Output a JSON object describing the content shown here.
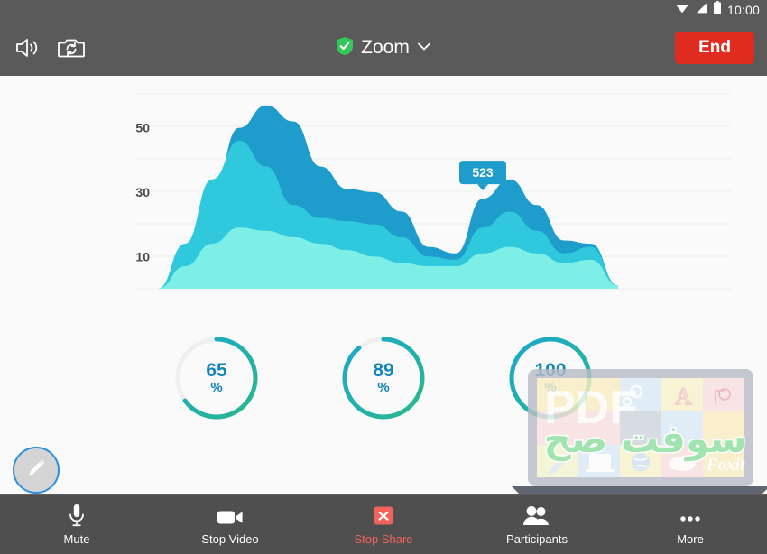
{
  "statusbar": {
    "time": "10:00",
    "icons": [
      "wifi-icon",
      "signal-icon",
      "battery-icon"
    ]
  },
  "topbar": {
    "speaker_icon": "speaker-icon",
    "switch_camera_icon": "switch-camera-icon",
    "shield_icon": "shield-check-icon",
    "title": "Zoom",
    "chevron_icon": "chevron-down-icon",
    "end_label": "End"
  },
  "annotate": {
    "pen_icon": "pencil-icon"
  },
  "chart_data": {
    "type": "area",
    "title": "",
    "xlabel": "",
    "ylabel": "",
    "ylim": [
      0,
      60
    ],
    "yticks": [
      10,
      30,
      50
    ],
    "ytick_labels": [
      "10",
      "30",
      "50"
    ],
    "grid": true,
    "legend": null,
    "stacked": true,
    "x": [
      0,
      1,
      2,
      3,
      4,
      5,
      6,
      7,
      8,
      9,
      10,
      11,
      12,
      13,
      14,
      15,
      16
    ],
    "series": [
      {
        "name": "series-3-dark",
        "color": "#1e9ccb",
        "values": [
          0,
          12,
          30,
          50,
          57,
          52,
          38,
          31,
          30,
          24,
          13,
          11,
          28,
          34,
          26,
          15,
          14,
          1
        ]
      },
      {
        "name": "series-2-teal",
        "color": "#2fc8dc",
        "values": [
          0,
          14,
          34,
          46,
          38,
          26,
          22,
          21,
          20,
          16,
          10,
          9,
          19,
          24,
          18,
          11,
          13,
          1
        ]
      },
      {
        "name": "series-1-light",
        "color": "#7defe6",
        "values": [
          0,
          7,
          14,
          19,
          18,
          16,
          14,
          12,
          10,
          8,
          7,
          7,
          11,
          13,
          11,
          8,
          9,
          1
        ]
      }
    ],
    "tooltip": {
      "value": "523",
      "background": "#1e9ccb",
      "text_color": "#ffffff",
      "x_index": 12
    }
  },
  "gauges": [
    {
      "name": "gauge-65",
      "value": 65,
      "value_label": "65",
      "unit": "%",
      "track_color": "#efefef",
      "start_color": "#2ab88c",
      "end_color": "#19a8cd"
    },
    {
      "name": "gauge-89",
      "value": 89,
      "value_label": "89",
      "unit": "%",
      "track_color": "#efefef",
      "start_color": "#2ab88c",
      "end_color": "#19a8cd"
    },
    {
      "name": "gauge-100",
      "value": 100,
      "value_label": "100",
      "unit": "%",
      "track_color": "#efefef",
      "start_color": "#2ab88c",
      "end_color": "#19a8cd"
    }
  ],
  "watermark": {
    "pdf_text": "PDF",
    "arabic_text": "سوفت صح",
    "brand_text": "Foxit"
  },
  "bottombar": {
    "items": [
      {
        "label": "Mute",
        "icon": "microphone-icon",
        "danger": false
      },
      {
        "label": "Stop Video",
        "icon": "video-camera-icon",
        "danger": false
      },
      {
        "label": "Stop Share",
        "icon": "stop-share-icon",
        "danger": true
      },
      {
        "label": "Participants",
        "icon": "participants-icon",
        "danger": false
      },
      {
        "label": "More",
        "icon": "more-dots-icon",
        "danger": false
      }
    ]
  },
  "colors": {
    "bar_background": "#5a5a5a",
    "toolbar_background": "#4f4f4f",
    "end_button": "#e02b20",
    "danger_text": "#f2635b",
    "accent_blue": "#1184b8",
    "shield_green": "#34c759"
  }
}
